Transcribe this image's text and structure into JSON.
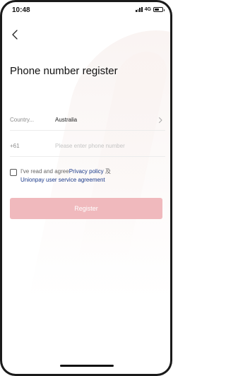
{
  "status_bar": {
    "time": "10:48",
    "network": "4G",
    "battery_level": 0.6
  },
  "header": {
    "back_icon": "chevron-left-icon"
  },
  "page": {
    "title": "Phone number register"
  },
  "form": {
    "country": {
      "label": "Country...",
      "value": "Australia",
      "icon": "chevron-right-icon"
    },
    "phone": {
      "prefix": "+61",
      "placeholder": "Please enter phone number"
    }
  },
  "agreement": {
    "checked": false,
    "prefix_text": "I've read and agree",
    "privacy_link": "Privacy policy",
    "conjunction": "及",
    "service_link": "Unionpay user service agreement"
  },
  "register_button": {
    "label": "Register"
  },
  "colors": {
    "accent_disabled": "#f0b9bd",
    "link": "#1b3a8a"
  }
}
